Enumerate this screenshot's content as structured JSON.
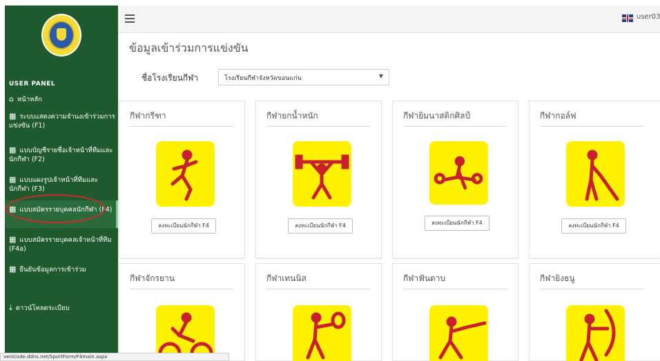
{
  "sidebar": {
    "panel_title": "USER PANEL",
    "items": [
      {
        "label": "หน้าหลัก",
        "icon": "home-icon"
      },
      {
        "label": "ระบบแสดงความจำนงเข้าร่วมการแข่งขัน (F1)",
        "icon": "file-icon"
      },
      {
        "label": "แบบบัญชีรายชื่อเจ้าหน้าที่ทีมและนักกีฬา (F2)",
        "icon": "file-icon"
      },
      {
        "label": "แบบแผงรูปเจ้าหน้าที่ทีมและนักกีฬา (F3)",
        "icon": "file-icon"
      },
      {
        "label": "แบบสมัครรายบุคคลนักกีฬา (F4)",
        "icon": "file-icon"
      },
      {
        "label": "แบบสมัครรายบุคคลเจ้าหน้าที่ทีม (F4a)",
        "icon": "file-icon"
      },
      {
        "label": "ยืนยันข้อมูลการเข้าร่วม",
        "icon": "file-icon"
      },
      {
        "label": "ดาวน์โหลดระเบียบ",
        "icon": "download-icon"
      }
    ]
  },
  "topbar": {
    "user": "user03"
  },
  "page": {
    "title": "ข้อมูลเข้าร่วมการแข่งขัน",
    "school_label": "ชื่อโรงเรียนกีฬา",
    "school_value": "โรงเรียนกีฬาจังหวัดขอนแก่น"
  },
  "cards": [
    {
      "title": "กีฬากรีฑา",
      "button": "ลงทะเบียนนักกีฬา F4",
      "icon": "athletics-icon"
    },
    {
      "title": "กีฬายกน้ำหนัก",
      "button": "ลงทะเบียนนักกีฬา F4",
      "icon": "weightlifting-icon"
    },
    {
      "title": "กีฬายิมนาสติกศิลป์",
      "button": "ลงทะเบียนนักกีฬา F4",
      "icon": "gymnastics-icon"
    },
    {
      "title": "กีฬากอล์ฟ",
      "button": "ลงทะเบียนนักกีฬา F4",
      "icon": "golf-icon"
    },
    {
      "title": "กีฬาจักรยาน",
      "icon": "cycling-icon"
    },
    {
      "title": "กีฬาเทนนิส",
      "icon": "tennis-icon"
    },
    {
      "title": "กีฬาฟันดาบ",
      "icon": "fencing-icon"
    },
    {
      "title": "กีฬายิงธนู",
      "icon": "archery-icon"
    }
  ],
  "status_url": "venicode.ddns.net/SportForm/F4main.aspx",
  "colors": {
    "sidebar": "#1e5a2e",
    "icon_bg": "#fff200",
    "figure": "#c8202d",
    "highlight": "#d02a2a"
  }
}
